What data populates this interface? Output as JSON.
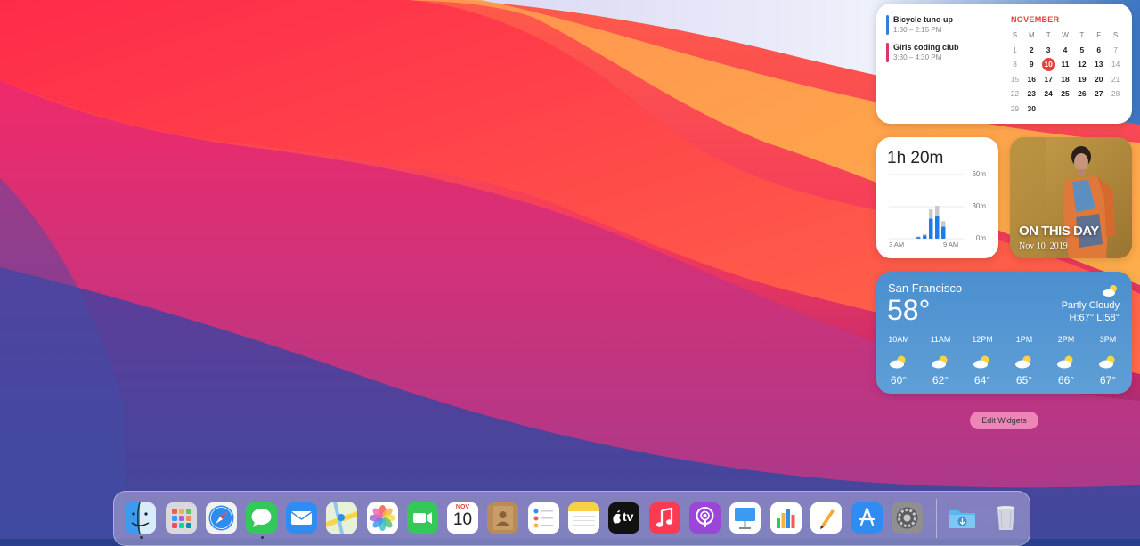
{
  "calendar": {
    "events": [
      {
        "title": "Bicycle tune-up",
        "time": "1:30 – 2:15 PM",
        "color": "#2f7fd8"
      },
      {
        "title": "Girls coding club",
        "time": "3:30 – 4:30 PM",
        "color": "#e0336b"
      }
    ],
    "month": "NOVEMBER",
    "weekdays": [
      "S",
      "M",
      "T",
      "W",
      "T",
      "F",
      "S"
    ],
    "weeks": [
      [
        "1",
        "2",
        "3",
        "4",
        "5",
        "6",
        "7"
      ],
      [
        "8",
        "9",
        "10",
        "11",
        "12",
        "13",
        "14"
      ],
      [
        "15",
        "16",
        "17",
        "18",
        "19",
        "20",
        "21"
      ],
      [
        "22",
        "23",
        "24",
        "25",
        "26",
        "27",
        "28"
      ],
      [
        "29",
        "30",
        "",
        "",
        "",
        "",
        ""
      ]
    ],
    "today": "10",
    "accent": "#e0433a"
  },
  "screentime": {
    "total": "1h 20m",
    "y_labels": [
      "60m",
      "30m",
      "0m"
    ],
    "x_labels": [
      "3 AM",
      "9 AM"
    ],
    "bars_minutes": [
      2,
      4,
      25,
      28,
      15
    ],
    "color": "#1a7cf0"
  },
  "photo": {
    "title": "ON THIS DAY",
    "date": "Nov 10, 2019"
  },
  "weather": {
    "city": "San Francisco",
    "temp": "58°",
    "condition": "Partly Cloudy",
    "high_low": "H:67° L:58°",
    "hours": [
      {
        "time": "10AM",
        "temp": "60°"
      },
      {
        "time": "11AM",
        "temp": "62°"
      },
      {
        "time": "12PM",
        "temp": "64°"
      },
      {
        "time": "1PM",
        "temp": "65°"
      },
      {
        "time": "2PM",
        "temp": "66°"
      },
      {
        "time": "3PM",
        "temp": "67°"
      }
    ]
  },
  "edit_widgets_label": "Edit Widgets",
  "dock": {
    "apps": [
      {
        "name": "finder-icon"
      },
      {
        "name": "launchpad-icon"
      },
      {
        "name": "safari-icon"
      },
      {
        "name": "messages-icon"
      },
      {
        "name": "mail-icon"
      },
      {
        "name": "maps-icon"
      },
      {
        "name": "photos-icon"
      },
      {
        "name": "facetime-icon"
      },
      {
        "name": "calendar-icon",
        "month": "NOV",
        "day": "10"
      },
      {
        "name": "contacts-icon"
      },
      {
        "name": "reminders-icon"
      },
      {
        "name": "notes-icon"
      },
      {
        "name": "tv-icon",
        "label": "tv"
      },
      {
        "name": "music-icon"
      },
      {
        "name": "podcasts-icon"
      },
      {
        "name": "keynote-icon"
      },
      {
        "name": "numbers-icon"
      },
      {
        "name": "pages-icon"
      },
      {
        "name": "app-store-icon"
      },
      {
        "name": "system-preferences-icon"
      },
      {
        "name": "downloads-folder-icon"
      },
      {
        "name": "trash-icon"
      }
    ]
  }
}
